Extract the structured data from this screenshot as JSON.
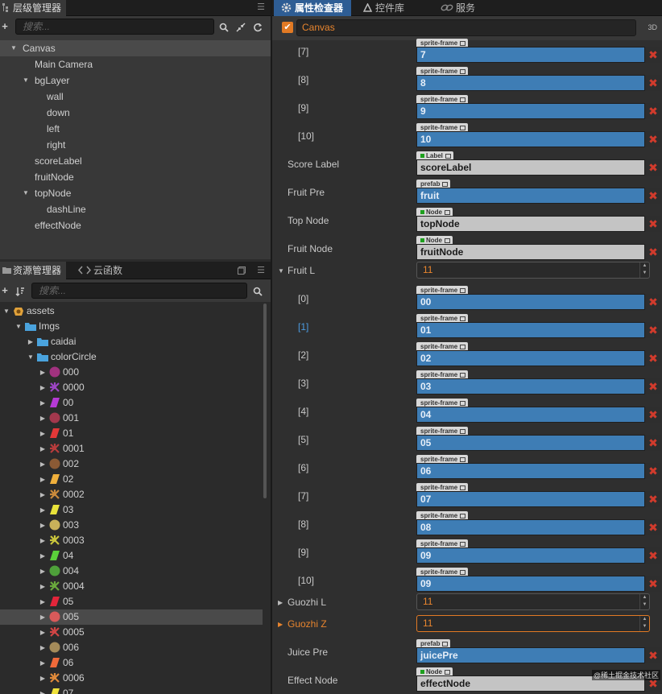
{
  "hierarchy": {
    "title": "层级管理器",
    "search_placeholder": "搜索...",
    "items": [
      "Canvas",
      "Main Camera",
      "bgLayer",
      "wall",
      "down",
      "left",
      "right",
      "scoreLabel",
      "fruitNode",
      "topNode",
      "dashLine",
      "effectNode"
    ]
  },
  "assets": {
    "tabs": [
      "资源管理器",
      "云函数"
    ],
    "search_placeholder": "搜索...",
    "items": [
      "assets",
      "Imgs",
      "caidai",
      "colorCircle",
      "000",
      "0000",
      "00",
      "001",
      "01",
      "0001",
      "002",
      "02",
      "0002",
      "03",
      "003",
      "0003",
      "04",
      "004",
      "0004",
      "05",
      "005",
      "0005",
      "006",
      "06",
      "0006",
      "07"
    ]
  },
  "inspector": {
    "tabs": [
      "属性检查器",
      "控件库",
      "服务"
    ],
    "node_name": "Canvas",
    "btn_3d": "3D",
    "labels": {
      "i7": "[7]",
      "i8": "[8]",
      "i9": "[9]",
      "i10": "[10]",
      "score": "Score Label",
      "fruitpre": "Fruit Pre",
      "topnode": "Top Node",
      "fruitnode": "Fruit Node",
      "fruitl": "Fruit L",
      "f0": "[0]",
      "f1": "[1]",
      "f2": "[2]",
      "f3": "[3]",
      "f4": "[4]",
      "f5": "[5]",
      "f6": "[6]",
      "f7": "[7]",
      "f8": "[8]",
      "f9": "[9]",
      "f10": "[10]",
      "guozhil": "Guozhi L",
      "guozhiz": "Guozhi Z",
      "juice": "Juice Pre",
      "effect": "Effect Node"
    },
    "tags": {
      "sprite": "sprite-frame",
      "label": "Label",
      "prefab": "prefab",
      "node": "Node"
    },
    "values": {
      "i7": "7",
      "i8": "8",
      "i9": "9",
      "i10": "10",
      "score": "scoreLabel",
      "fruitpre": "fruit",
      "topnode": "topNode",
      "fruitnode": "fruitNode",
      "fruitl": "11",
      "f0": "00",
      "f1": "01",
      "f2": "02",
      "f3": "03",
      "f4": "04",
      "f5": "05",
      "f6": "06",
      "f7": "07",
      "f8": "08",
      "f9": "09",
      "f10": "09",
      "guozhil": "11",
      "guozhiz": "11",
      "juice": "juicePre",
      "effect": "effectNode"
    },
    "remove": "✖"
  },
  "watermark": "@稀土掘金技术社区"
}
